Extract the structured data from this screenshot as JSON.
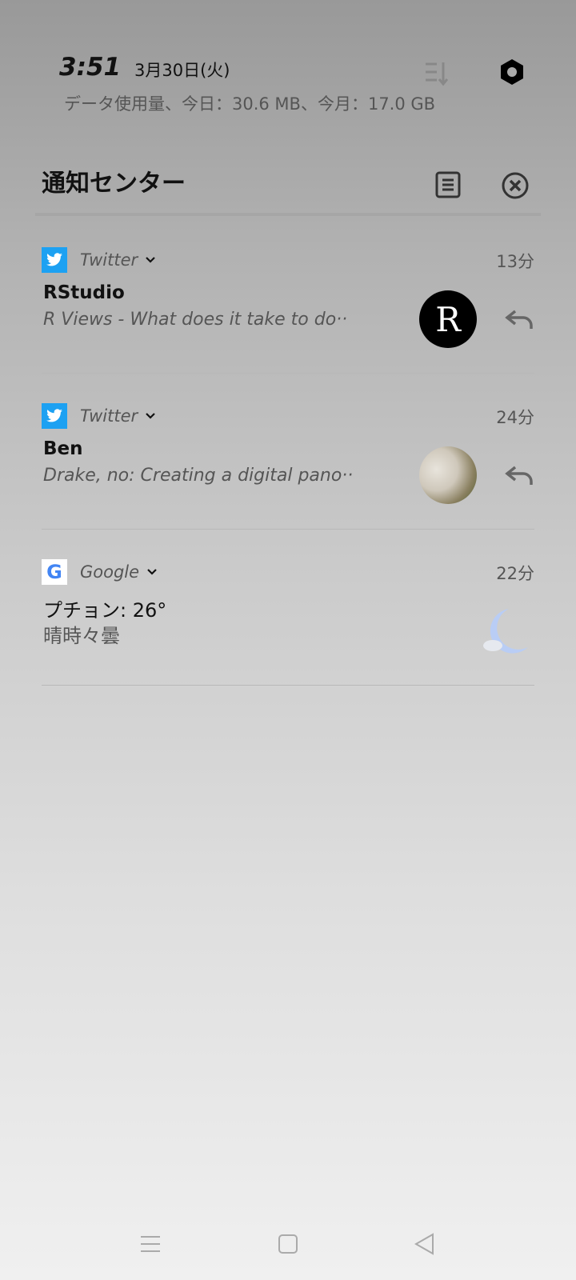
{
  "status": {
    "time": "3:51",
    "date": "3月30日(火)",
    "data_usage": "データ使用量、今日：30.6 MB、今月：17.0 GB"
  },
  "header": {
    "title": "通知センター"
  },
  "notifications": [
    {
      "app": "Twitter",
      "time": "13分",
      "title": "RStudio",
      "body": "R Views - What does it take to do··",
      "avatar_letter": "R"
    },
    {
      "app": "Twitter",
      "time": "24分",
      "title": "Ben",
      "body": "Drake, no: Creating a digital pano··"
    },
    {
      "app": "Google",
      "time": "22分",
      "title": "プチョン: 26°",
      "body": "晴時々曇"
    }
  ],
  "colors": {
    "twitter": "#1da1f2",
    "moon": "#b9cdf5"
  }
}
